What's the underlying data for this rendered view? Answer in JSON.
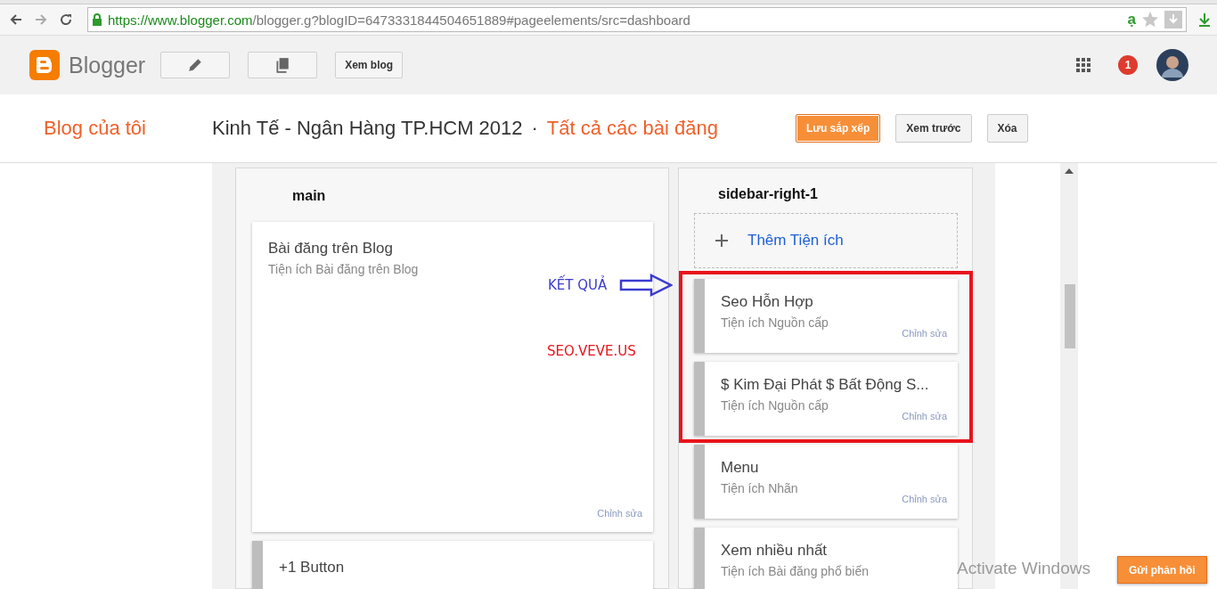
{
  "browser": {
    "url_secure": "https://www.blogger.com",
    "url_rest": "/blogger.g?blogID=6473331844504651889#pageelements/src=dashboard",
    "extension_label": "ạ"
  },
  "header": {
    "logo_text": "Blogger",
    "view_blog": "Xem blog",
    "notification_count": "1"
  },
  "title_bar": {
    "my_blogs": "Blog của tôi",
    "blog_name": "Kinh Tế - Ngân Hàng TP.HCM 2012",
    "separator": "·",
    "section": "Tất cả các bài đăng",
    "buttons": [
      {
        "label": "Lưu sắp xếp",
        "kind": "primary"
      },
      {
        "label": "Xem trước",
        "kind": "default"
      },
      {
        "label": "Xóa",
        "kind": "default"
      }
    ]
  },
  "main_column": {
    "title": "main",
    "widgets": [
      {
        "title": "Bài đăng trên Blog",
        "subtitle": "Tiện ích Bài đăng trên Blog",
        "edit": "Chỉnh sửa",
        "draggable": false
      },
      {
        "title": "+1 Button",
        "draggable": true
      }
    ]
  },
  "sidebar_column": {
    "title": "sidebar-right-1",
    "add_gadget": "Thêm Tiện ích",
    "widgets": [
      {
        "title": "Seo Hỗn Hợp",
        "subtitle": "Tiện ích Nguồn cấp",
        "edit": "Chỉnh sửa",
        "draggable": true,
        "highlighted": true
      },
      {
        "title": "$ Kim Đại Phát $ Bất Động S...",
        "subtitle": "Tiện ích Nguồn cấp",
        "edit": "Chỉnh sửa",
        "draggable": true,
        "highlighted": true
      },
      {
        "title": "Menu",
        "subtitle": "Tiện ích Nhãn",
        "edit": "Chỉnh sửa",
        "draggable": true,
        "highlighted": false
      },
      {
        "title": "Xem nhiều nhất",
        "subtitle": "Tiện ích Bài đăng phổ biến",
        "draggable": true,
        "highlighted": false
      }
    ]
  },
  "annotations": [
    {
      "text": "KẾT QUẢ",
      "kind": "arrow-label",
      "color": "#3b3bd0"
    },
    {
      "text": "SEO.VEVE.US",
      "kind": "plain",
      "color": "#e8141c"
    }
  ],
  "feedback_button": "Gửi phản hồi",
  "os_watermark": "Activate Windows"
}
